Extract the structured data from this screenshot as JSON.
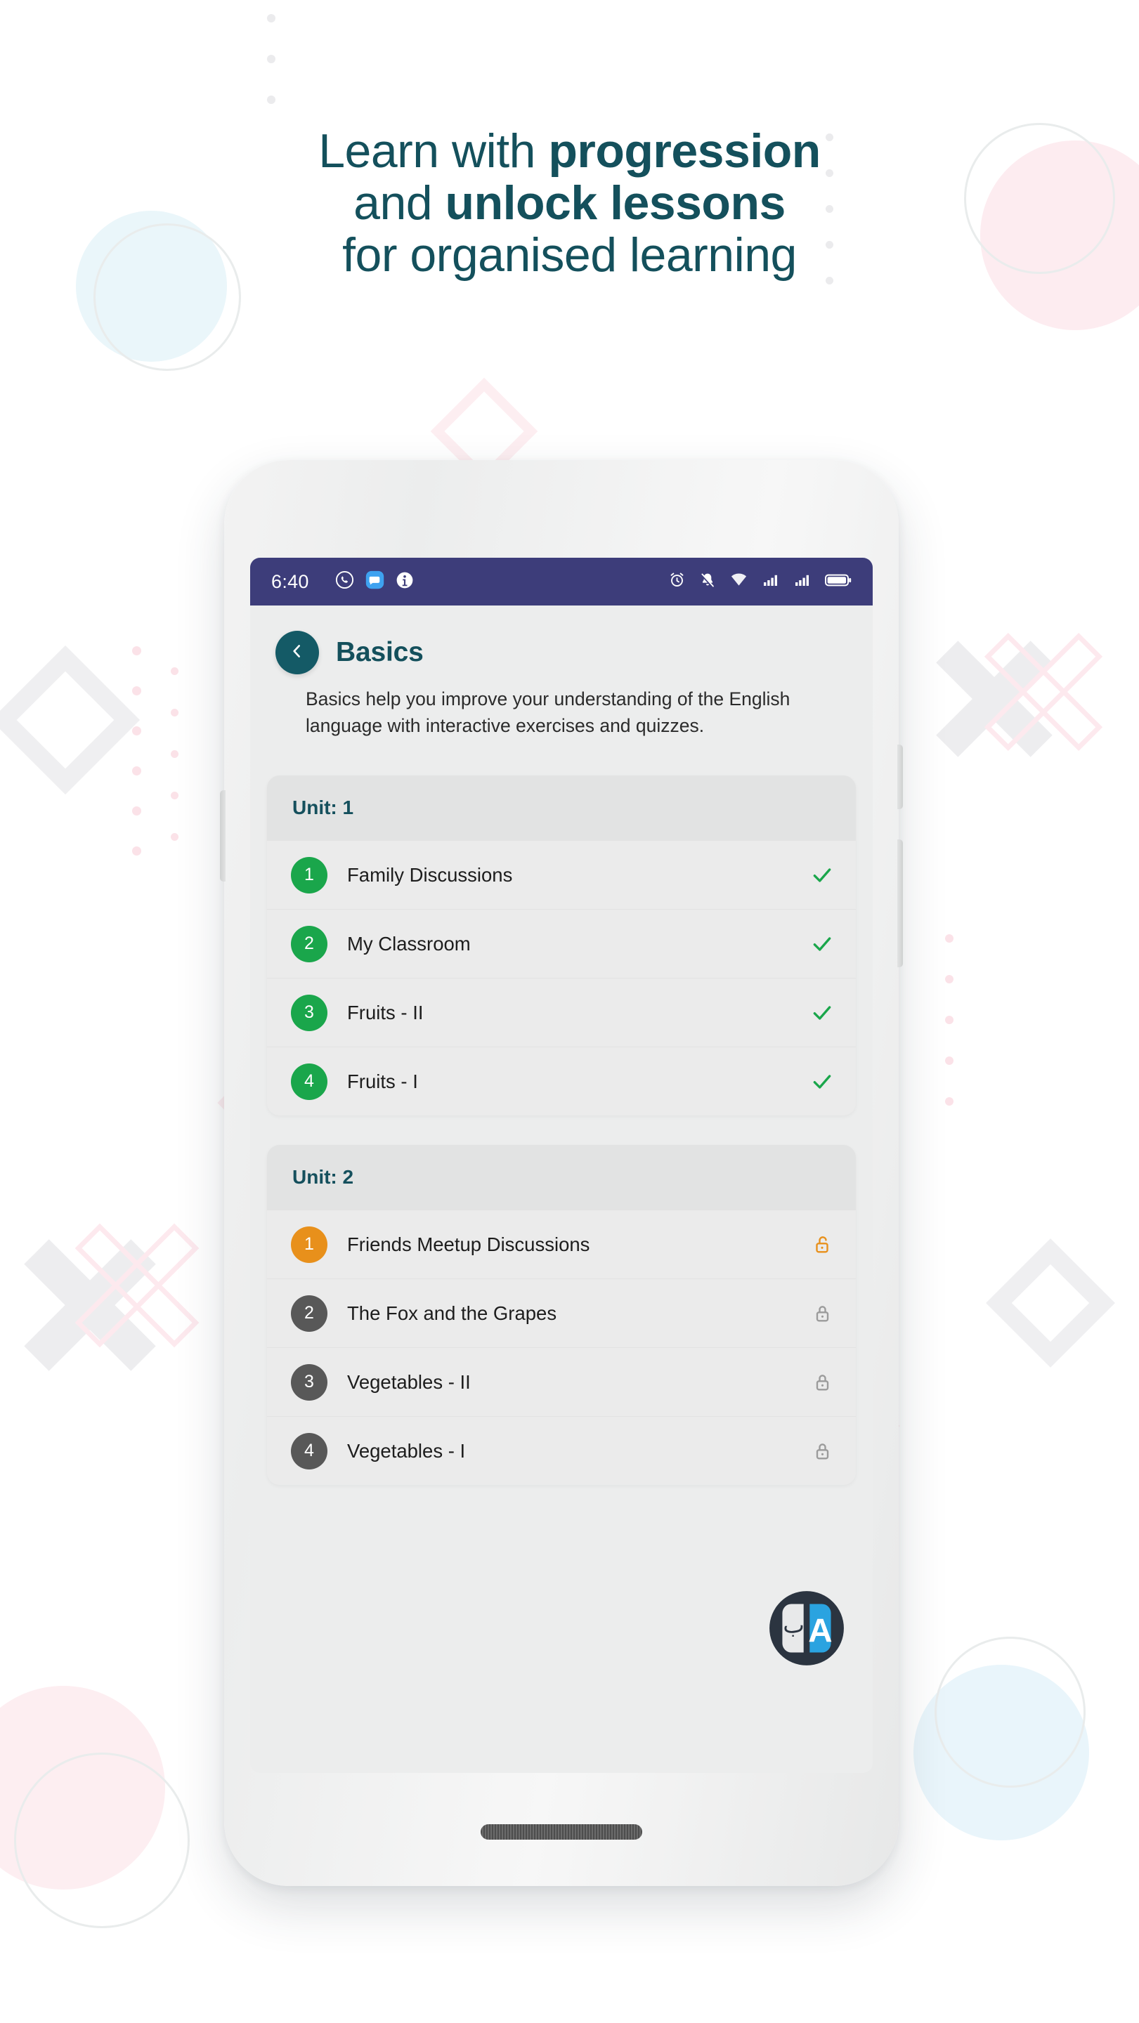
{
  "promo": {
    "headline_lines": [
      {
        "normal": "Learn with ",
        "bold": "progression"
      },
      {
        "normal": "and ",
        "bold": "unlock lessons"
      },
      {
        "normal": "for organised learning",
        "bold": ""
      }
    ],
    "headline_color": "#14505c"
  },
  "status_bar": {
    "time": "6:40",
    "left_icons": [
      "whatsapp-icon",
      "messages-icon",
      "info-icon"
    ],
    "right_icons": [
      "alarm-icon",
      "notifications-off-icon",
      "wifi-icon",
      "signal-sim1-icon",
      "signal-sim2-icon",
      "battery-icon"
    ],
    "background": "#3d3d7a"
  },
  "screen": {
    "back_button": "back-chevron-icon",
    "title": "Basics",
    "description": "Basics help you improve your understanding of the English language with interactive exercises and quizzes.",
    "accent_color": "#14505c"
  },
  "units": [
    {
      "header": "Unit: 1",
      "lessons": [
        {
          "number": "1",
          "title": "Family Discussions",
          "state": "done",
          "status_icon": "check-icon"
        },
        {
          "number": "2",
          "title": "My Classroom",
          "state": "done",
          "status_icon": "check-icon"
        },
        {
          "number": "3",
          "title": "Fruits - II",
          "state": "done",
          "status_icon": "check-icon"
        },
        {
          "number": "4",
          "title": "Fruits - I",
          "state": "done",
          "status_icon": "check-icon"
        }
      ]
    },
    {
      "header": "Unit: 2",
      "lessons": [
        {
          "number": "1",
          "title": "Friends Meetup Discussions",
          "state": "current",
          "status_icon": "unlock-icon"
        },
        {
          "number": "2",
          "title": "The Fox and the Grapes",
          "state": "locked",
          "status_icon": "lock-icon"
        },
        {
          "number": "3",
          "title": "Vegetables - II",
          "state": "locked",
          "status_icon": "lock-icon"
        },
        {
          "number": "4",
          "title": "Vegetables - I",
          "state": "locked",
          "status_icon": "lock-icon"
        }
      ]
    }
  ],
  "app_logo": {
    "name": "app-logo-icon",
    "left_glyph": "ب",
    "right_glyph": "A",
    "colors": {
      "circle": "#2b3440",
      "left_panel": "#e8e9ea",
      "right_panel": "#2aa3e0"
    }
  },
  "colors": {
    "done": "#1aa64b",
    "current": "#e8901b",
    "locked": "#585858",
    "lock_locked": "#9b9b9b",
    "lock_current": "#e8901b",
    "teal": "#14505c"
  }
}
